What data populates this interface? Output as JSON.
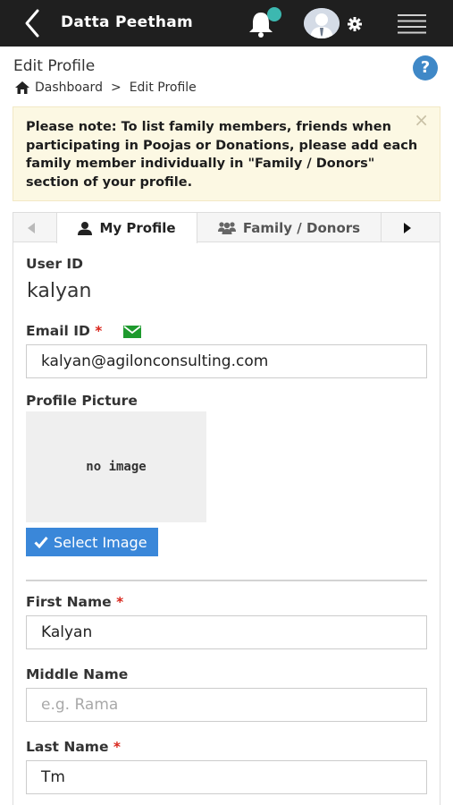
{
  "topbar": {
    "title": "Datta Peetham",
    "back_icon": "chevron-left-icon",
    "notification_icon": "bell-icon",
    "avatar_icon": "user-avatar-icon",
    "settings_icon": "gear-icon",
    "menu_icon": "hamburger-icon"
  },
  "header": {
    "title": "Edit Profile",
    "help_label": "?",
    "breadcrumb": {
      "home_label": "Dashboard",
      "separator": ">",
      "current": "Edit Profile"
    }
  },
  "alert": {
    "text": "Please note: To list family members, friends when participating in Poojas or Donations, please add each family member individually in \"Family / Donors\" section of your profile.",
    "close_label": "×",
    "background": "#fcf8e3"
  },
  "tabs": {
    "prev_icon": "caret-left-icon",
    "items": [
      {
        "label": "My Profile",
        "icon": "user-icon",
        "active": true
      },
      {
        "label": "Family / Donors",
        "icon": "users-icon",
        "active": false
      }
    ],
    "next_icon": "caret-right-icon"
  },
  "form": {
    "user_id": {
      "label": "User ID",
      "value": "kalyan"
    },
    "email": {
      "label": "Email ID",
      "required_mark": "*",
      "value": "kalyan@agilonconsulting.com",
      "verified_icon": "envelope-icon"
    },
    "profile_picture": {
      "label": "Profile Picture",
      "placeholder_text": "no image",
      "button_label": "Select Image"
    },
    "first_name": {
      "label": "First Name",
      "required_mark": "*",
      "value": "Kalyan"
    },
    "middle_name": {
      "label": "Middle Name",
      "placeholder": "e.g. Rama",
      "value": ""
    },
    "last_name": {
      "label": "Last Name",
      "required_mark": "*",
      "value": "Tm"
    }
  },
  "colors": {
    "topbar": "#1f1f1f",
    "accent_blue": "#3a87d9",
    "notification_dot": "#3cb8b0",
    "required": "#d9261c",
    "verified_green": "#1e9a2e"
  }
}
